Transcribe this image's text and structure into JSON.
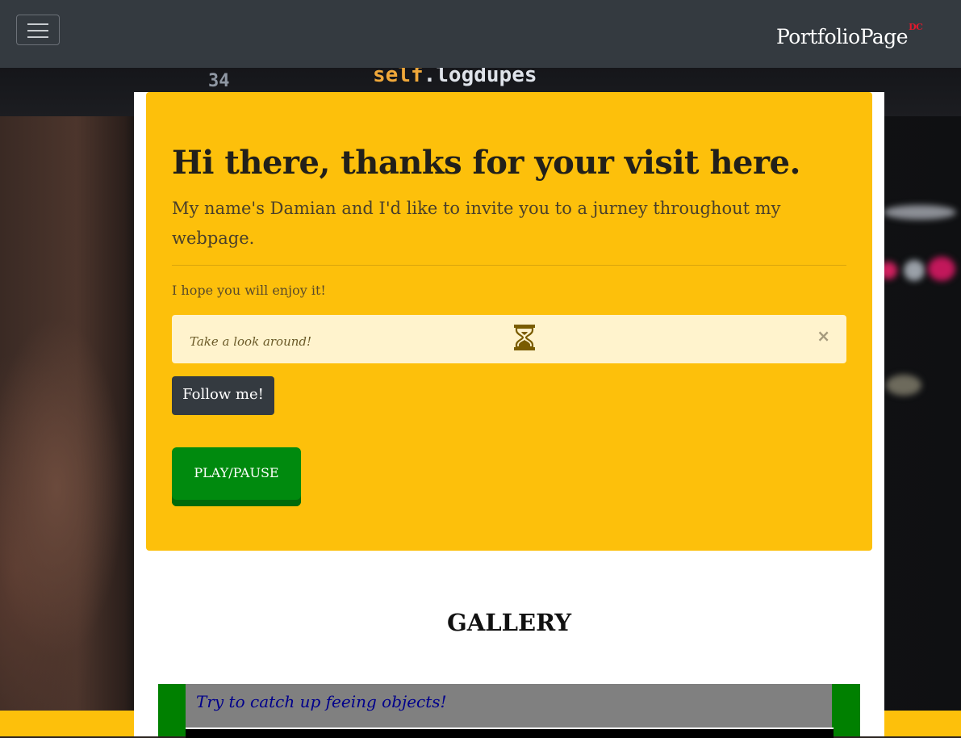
{
  "navbar": {
    "toggler_icon": "hamburger-icon",
    "brand": "PortfolioPage",
    "brand_sup": "DC"
  },
  "hero": {
    "title": "Hi there, thanks for your visit here.",
    "lead": "My name's Damian and I'd like to invite you to a jurney throughout my webpage.",
    "subtext": "I hope you will enjoy it!",
    "alert": {
      "text": "Take a look around!",
      "icon": "hourglass-icon",
      "close": "×"
    },
    "follow_button": "Follow me!",
    "play_button": "PLAY/PAUSE"
  },
  "gallery": {
    "title": "GALLERY",
    "game_caption": "Try to catch up feeing objects!"
  },
  "colors": {
    "navbar": "#343a40",
    "jumbotron": "#fdc00b",
    "alert": "#fff3cd",
    "play_button": "#008a0e",
    "brand_sup": "#e0192d",
    "game_frame": "#008000"
  }
}
